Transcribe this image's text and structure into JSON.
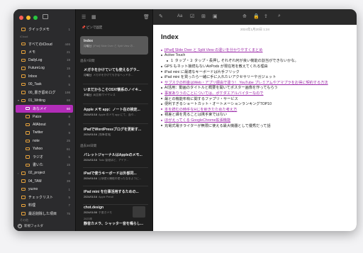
{
  "colors": {
    "accent": "#b22db8",
    "link": "#9b2aa8",
    "folder": "#e6a23c"
  },
  "sidebar": {
    "quick_notes": {
      "label": "クイックメモ",
      "count": "1"
    },
    "section_icloud": "iCloud",
    "items": [
      {
        "label": "すべてのiCloud",
        "count": "446"
      },
      {
        "label": "メモ",
        "count": "21"
      },
      {
        "label": "DailyLog",
        "count": "19"
      },
      {
        "label": "FutureLog",
        "count": "15"
      },
      {
        "label": "Inbox",
        "count": "6"
      },
      {
        "label": "00_Task",
        "count": "5"
      },
      {
        "label": "00_書き留めログ",
        "count": "198"
      },
      {
        "label": "01_Writing",
        "count": "68"
      },
      {
        "label": "あなメイ",
        "count": "60"
      },
      {
        "label": "Paize",
        "count": "8"
      },
      {
        "label": "AllAbout",
        "count": "8"
      },
      {
        "label": "Twitter",
        "count": "9"
      },
      {
        "label": "note",
        "count": "25"
      },
      {
        "label": "Yahoo",
        "count": "61"
      },
      {
        "label": "ラジオ",
        "count": "5"
      },
      {
        "label": "書いた",
        "count": "15"
      },
      {
        "label": "02_project",
        "count": "0"
      },
      {
        "label": "04_TAM",
        "count": "39"
      },
      {
        "label": "yuzno",
        "count": "1"
      },
      {
        "label": "チェックリスト",
        "count": "5"
      },
      {
        "label": "料理",
        "count": "7"
      },
      {
        "label": "最近削除した項目",
        "count": "75"
      }
    ],
    "section_other": "その他",
    "new_folder": "新規フォルダ"
  },
  "notelist": {
    "pinned_label": "ピンで固定",
    "groups": [
      "過去7日間",
      "過去30日間",
      "2023年"
    ],
    "notes": [
      {
        "title": "Index",
        "date": "月曜日",
        "preview": "[iPad] Slide Over と Split View の..."
      },
      {
        "title": "メガネをかけていても使えるグラ...",
        "date": "月曜日",
        "preview": "メガネをかけてもかなヘッドホ..."
      },
      {
        "title": "いまだからこそOSX!懐系のノイキ...",
        "date": "木曜日",
        "preview": "高音質!ワイヤレス"
      },
      {
        "title": "Apple メモ app：ノート在の検定...",
        "date": "2024/01/18",
        "preview": "Apple のメモ app にて、面々..."
      },
      {
        "title": "iPadでWordPressブログを更新す...",
        "date": "2024/01/16",
        "preview": "[執筆環境]"
      },
      {
        "title": "バレットジャーナルはAppleのメモ...",
        "date": "2024/01/16",
        "preview": "Todo 管理ほど、アイデ..."
      },
      {
        "title": "iPadで使うキーボードは外部同...",
        "date": "2024/01/16",
        "preview": "日頃使え機能の使ったなるように..."
      },
      {
        "title": "iPad mini を仕事活用するための...",
        "date": "2024/01/16",
        "preview": "Apple Pencil"
      },
      {
        "title": "chot.design",
        "date": "2024/01/08",
        "preview": "手書きメモ"
      },
      {
        "title": "静音カメラ、シャッター音を鳴らし...",
        "date": "2023/11/22",
        "preview": "撮影データをそのまま..."
      }
    ]
  },
  "editor": {
    "date": "2024年1月20日 1:24",
    "title": "Index",
    "lines": [
      {
        "text": "[iPad] Slide Over と Split View の違いを分かりやすくまとめ",
        "style": "link"
      },
      {
        "text": "Active Touch",
        "style": "normal"
      },
      {
        "text": "１ タップ・２ タップ・長押し  それぞれ何が良い機能の割当ができないかな。",
        "style": "sub"
      },
      {
        "text": "GPS もネット接続もないAirPods が現在地を教えてくれる理由",
        "style": "normal"
      },
      {
        "text": "iPad mini に最適なキーボードは片手フリック",
        "style": "normal"
      },
      {
        "text": "iPad mini を買ったら一緒に手に入れたいアクセサリーやガジェット",
        "style": "normal"
      },
      {
        "text": "サブスクの料金はWeb・アプリ経由で違う！ YouTube プレミアムやアマプラをお得に契約する方法",
        "style": "link"
      },
      {
        "text": "AI活用：動画のタイトルと概要を開いてポスター画像を作ってもらう",
        "style": "normal"
      },
      {
        "text": "事家ありうのことについては、ポケダエアルバイターなので",
        "style": "link"
      },
      {
        "text": "最との機能布有に関するファプリ・サービス",
        "style": "normal"
      },
      {
        "text": "便利すぎるショートカット・オートメーションランキングTOP10",
        "style": "normal"
      },
      {
        "text": "本を読むの時手なHじを射きたためた考え方",
        "style": "link"
      },
      {
        "text": "視差と縁を見ることは携手束ではない",
        "style": "normal"
      },
      {
        "text": "ほがえってくる GoogleChrome拡張機能",
        "style": "link"
      },
      {
        "text": "充電式電子ライターが無限に使える最大機器として優秀だって話",
        "style": "normal"
      }
    ]
  }
}
